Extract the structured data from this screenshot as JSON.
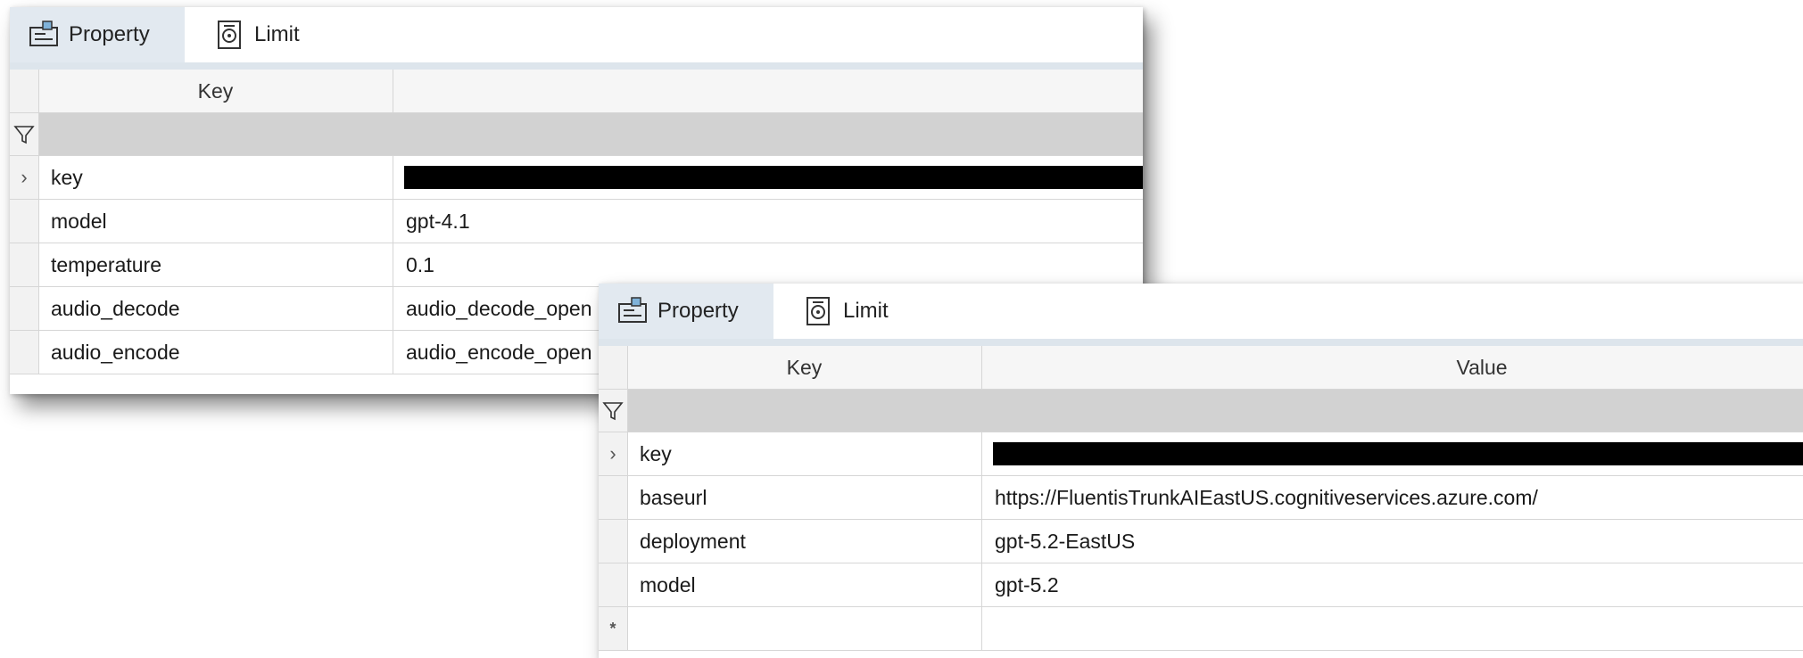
{
  "panels": [
    {
      "tabs": {
        "property_label": "Property",
        "limit_label": "Limit"
      },
      "columns": {
        "key": "Key",
        "value": ""
      },
      "rows": [
        {
          "key": "key",
          "value": ""
        },
        {
          "key": "model",
          "value": "gpt-4.1"
        },
        {
          "key": "temperature",
          "value": "0.1"
        },
        {
          "key": "audio_decode",
          "value": "audio_decode_open"
        },
        {
          "key": "audio_encode",
          "value": "audio_encode_open"
        }
      ]
    },
    {
      "tabs": {
        "property_label": "Property",
        "limit_label": "Limit"
      },
      "columns": {
        "key": "Key",
        "value": "Value"
      },
      "rows": [
        {
          "key": "key",
          "value": ""
        },
        {
          "key": "baseurl",
          "value": "https://FluentisTrunkAIEastUS.cognitiveservices.azure.com/"
        },
        {
          "key": "deployment",
          "value": "gpt-5.2-EastUS"
        },
        {
          "key": "model",
          "value": "gpt-5.2"
        },
        {
          "key": "",
          "value": ""
        }
      ],
      "new_row_marker": "*"
    }
  ],
  "icons": {
    "property_tab": "property-card-icon",
    "limit_tab": "limit-gauge-icon",
    "filter": "funnel-filter-icon",
    "expand": "chevron-right-icon"
  },
  "colors": {
    "tab_active_bg": "#e2e9f0",
    "filter_row_bg": "#d2d2d2",
    "redaction": "#000000"
  }
}
